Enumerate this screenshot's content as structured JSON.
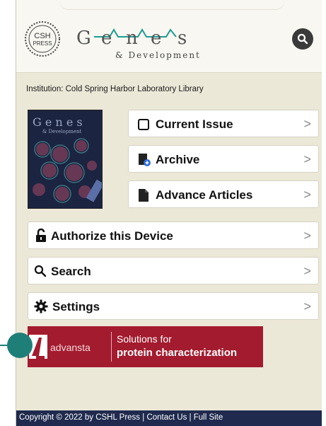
{
  "header": {
    "cshl_logo_text": "CSH PRESS",
    "journal_logo_text": "Genes & Development",
    "search_label": "search"
  },
  "institution": "Institution: Cold Spring Harbor Laboratory Library",
  "cover": {
    "alt": "Genes & Development cover"
  },
  "menu": {
    "current_issue": "Current Issue",
    "archive": "Archive",
    "advance_articles": "Advance Articles",
    "authorize": "Authorize this Device",
    "search": "Search",
    "settings": "Settings",
    "chevron": ">"
  },
  "ad": {
    "brand": "advansta",
    "tagline_1": "Solutions for",
    "tagline_2": "protein characterization"
  },
  "footer": {
    "copyright": "Copyright © 2022 by CSHL Press",
    "sep": " | ",
    "contact": "Contact Us",
    "full_site": "Full Site"
  },
  "colors": {
    "background": "#ece8d8",
    "footer": "#1f2a4e",
    "ad": "#a31b2e",
    "accent_teal": "#1e7f78"
  }
}
